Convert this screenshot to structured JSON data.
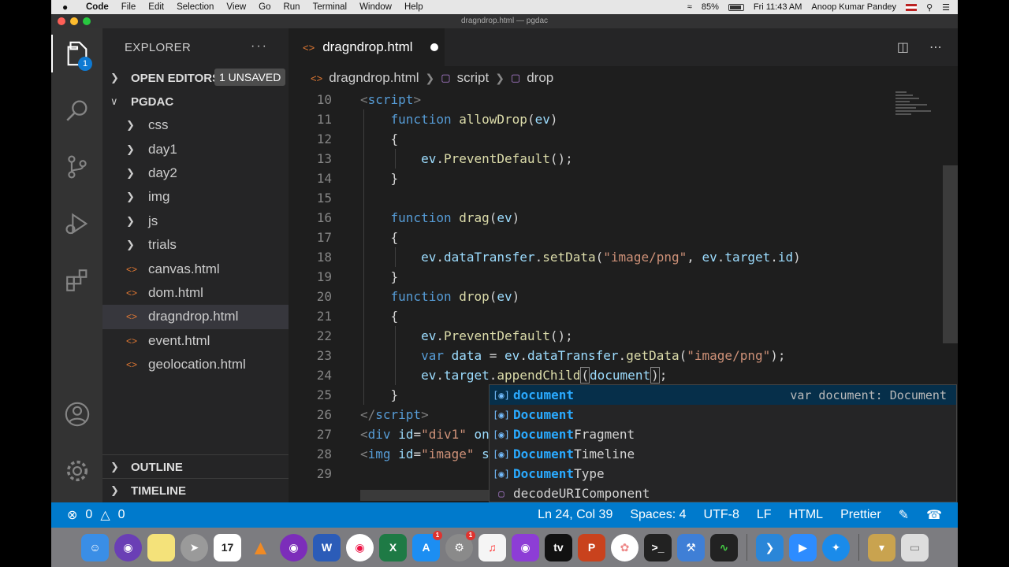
{
  "menubar": {
    "apple": "",
    "items": [
      "Code",
      "File",
      "Edit",
      "Selection",
      "View",
      "Go",
      "Run",
      "Terminal",
      "Window",
      "Help"
    ],
    "battery": "85%",
    "clock": "Fri 11:43 AM",
    "user": "Anoop Kumar Pandey"
  },
  "window": {
    "title": "dragndrop.html — pgdac"
  },
  "activity": {
    "explorer_badge": "1"
  },
  "sidebar": {
    "title": "EXPLORER",
    "more": "···",
    "open_editors": "OPEN EDITORS",
    "unsaved": "1 UNSAVED",
    "folder": "PGDAC",
    "folders": [
      "css",
      "day1",
      "day2",
      "img",
      "js",
      "trials"
    ],
    "files": [
      "canvas.html",
      "dom.html",
      "dragndrop.html",
      "event.html",
      "geolocation.html"
    ],
    "outline": "OUTLINE",
    "timeline": "TIMELINE"
  },
  "editor": {
    "tab": "dragndrop.html",
    "breadcrumb": {
      "file": "dragndrop.html",
      "script": "script",
      "fn": "drop"
    },
    "line_numbers": [
      "10",
      "11",
      "12",
      "13",
      "14",
      "15",
      "16",
      "17",
      "18",
      "19",
      "20",
      "21",
      "22",
      "23",
      "24",
      "25",
      "26",
      "27",
      "28",
      "29"
    ]
  },
  "suggest": {
    "items": [
      {
        "hl": "document",
        "rest": ""
      },
      {
        "hl": "Document",
        "rest": ""
      },
      {
        "hl": "Document",
        "rest": "Fragment"
      },
      {
        "hl": "Document",
        "rest": "Timeline"
      },
      {
        "hl": "Document",
        "rest": "Type"
      }
    ],
    "detail": "var document: Document",
    "last": "decodeURIComponent"
  },
  "status": {
    "errors": "0",
    "warnings": "0",
    "position": "Ln 24, Col 39",
    "spaces": "Spaces: 4",
    "encoding": "UTF-8",
    "eol": "LF",
    "language": "HTML",
    "formatter": "Prettier"
  },
  "dock": {
    "calendar_day": "17",
    "app_store_badge": "1",
    "settings_badge": "1"
  }
}
